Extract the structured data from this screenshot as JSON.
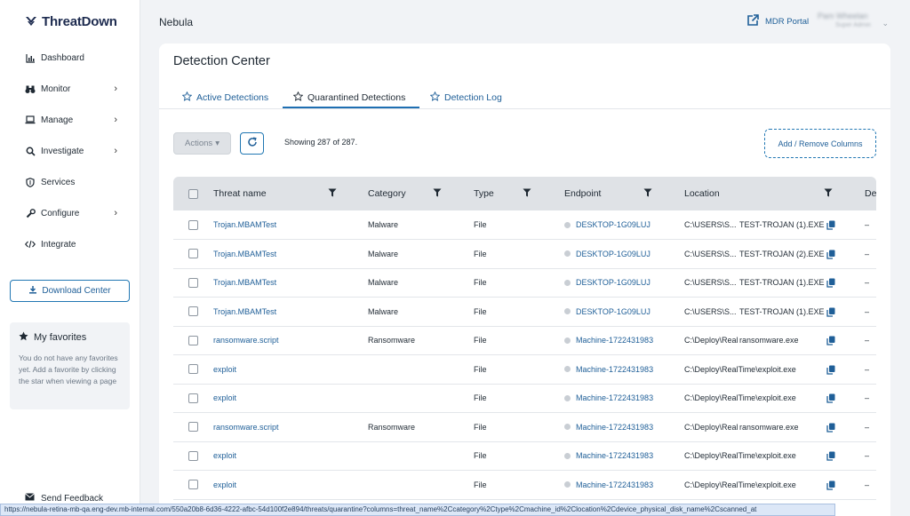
{
  "app": {
    "logo_text": "ThreatDown",
    "workspace": "Nebula",
    "mdr_label": "MDR Portal",
    "user_name": "Pam Wheelan",
    "user_role": "Super Admin"
  },
  "sidebar": {
    "items": [
      {
        "label": "Dashboard",
        "icon": "bar-chart-icon",
        "has_chevron": false
      },
      {
        "label": "Monitor",
        "icon": "binoculars-icon",
        "has_chevron": true
      },
      {
        "label": "Manage",
        "icon": "laptop-icon",
        "has_chevron": true
      },
      {
        "label": "Investigate",
        "icon": "search-icon",
        "has_chevron": true
      },
      {
        "label": "Services",
        "icon": "shield-icon",
        "has_chevron": false
      },
      {
        "label": "Configure",
        "icon": "wrench-icon",
        "has_chevron": true
      },
      {
        "label": "Integrate",
        "icon": "code-icon",
        "has_chevron": false
      }
    ],
    "download_label": "Download Center",
    "favorites_title": "My favorites",
    "favorites_text": "You do not have any favorites yet. Add a favorite by clicking the star when viewing a page",
    "feedback_label": "Send Feedback"
  },
  "main": {
    "title": "Detection Center",
    "tabs": [
      {
        "label": "Active Detections",
        "active": false
      },
      {
        "label": "Quarantined Detections",
        "active": true
      },
      {
        "label": "Detection Log",
        "active": false
      }
    ],
    "actions_label": "Actions",
    "showing_text": "Showing 287 of 287.",
    "add_columns_label": "Add / Remove Columns",
    "columns": [
      "Threat name",
      "Category",
      "Type",
      "Endpoint",
      "Location",
      "De"
    ],
    "rows": [
      {
        "threat": "Trojan.MBAMTest",
        "category": "Malware",
        "type": "File",
        "endpoint": "DESKTOP-1G09LUJ",
        "loc_dir": "C:\\USERS\\S...",
        "loc_file": "TEST-TROJAN (1).EXE",
        "extra": "–"
      },
      {
        "threat": "Trojan.MBAMTest",
        "category": "Malware",
        "type": "File",
        "endpoint": "DESKTOP-1G09LUJ",
        "loc_dir": "C:\\USERS\\S...",
        "loc_file": "TEST-TROJAN (2).EXE",
        "extra": "–"
      },
      {
        "threat": "Trojan.MBAMTest",
        "category": "Malware",
        "type": "File",
        "endpoint": "DESKTOP-1G09LUJ",
        "loc_dir": "C:\\USERS\\S...",
        "loc_file": "TEST-TROJAN (1).EXE",
        "extra": "–"
      },
      {
        "threat": "Trojan.MBAMTest",
        "category": "Malware",
        "type": "File",
        "endpoint": "DESKTOP-1G09LUJ",
        "loc_dir": "C:\\USERS\\S...",
        "loc_file": "TEST-TROJAN (1).EXE",
        "extra": "–"
      },
      {
        "threat": "ransomware.script",
        "category": "Ransomware",
        "type": "File",
        "endpoint": "Machine-1722431983",
        "loc_dir": "C:\\Deploy\\RealTi...",
        "loc_file": "ransomware.exe",
        "extra": "–"
      },
      {
        "threat": "exploit",
        "category": "",
        "type": "File",
        "endpoint": "Machine-1722431983",
        "loc_dir": "C:\\Deploy\\RealTime\\exploit.exe",
        "loc_file": "",
        "extra": "–"
      },
      {
        "threat": "exploit",
        "category": "",
        "type": "File",
        "endpoint": "Machine-1722431983",
        "loc_dir": "C:\\Deploy\\RealTime\\exploit.exe",
        "loc_file": "",
        "extra": "–"
      },
      {
        "threat": "ransomware.script",
        "category": "Ransomware",
        "type": "File",
        "endpoint": "Machine-1722431983",
        "loc_dir": "C:\\Deploy\\RealTi...",
        "loc_file": "ransomware.exe",
        "extra": "–"
      },
      {
        "threat": "exploit",
        "category": "",
        "type": "File",
        "endpoint": "Machine-1722431983",
        "loc_dir": "C:\\Deploy\\RealTime\\exploit.exe",
        "loc_file": "",
        "extra": "–"
      },
      {
        "threat": "exploit",
        "category": "",
        "type": "File",
        "endpoint": "Machine-1722431983",
        "loc_dir": "C:\\Deploy\\RealTime\\exploit.exe",
        "loc_file": "",
        "extra": "–"
      }
    ]
  },
  "statusbar": {
    "url": "https://nebula-retina-mb-qa.eng-dev.mb-internal.com/550a20b8-6d36-4222-afbc-54d100f2e894/threats/quarantine?columns=threat_name%2Ccategory%2Ctype%2Cmachine_id%2Clocation%2Cdevice_physical_disk_name%2Cscanned_at"
  },
  "colors": {
    "accent": "#1f5f98",
    "border_accent": "#2177b3",
    "header_bg": "#dfe2e6",
    "page_bg": "#f1f3f6"
  }
}
